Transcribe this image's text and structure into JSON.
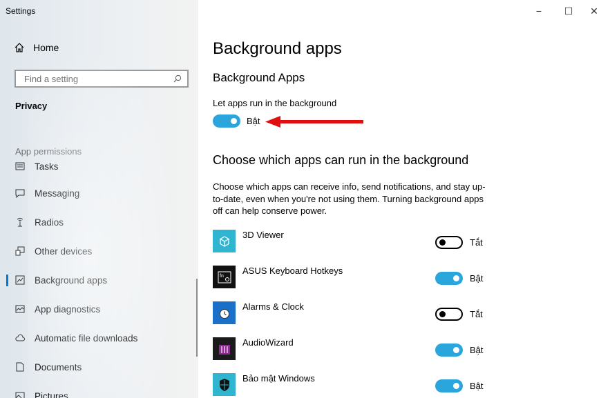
{
  "window": {
    "title": "Settings",
    "minimize": "−",
    "maximize": "☐",
    "close": "✕"
  },
  "sidebar": {
    "home_label": "Home",
    "search_placeholder": "Find a setting",
    "section_label": "Privacy",
    "group_label": "App permissions",
    "items": [
      {
        "label": "Tasks",
        "icon": "tasks-icon"
      },
      {
        "label": "Messaging",
        "icon": "messaging-icon"
      },
      {
        "label": "Radios",
        "icon": "radios-icon"
      },
      {
        "label": "Other devices",
        "icon": "other-devices-icon"
      },
      {
        "label": "Background apps",
        "icon": "background-apps-icon",
        "active": true
      },
      {
        "label": "App diagnostics",
        "icon": "app-diagnostics-icon"
      },
      {
        "label": "Automatic file downloads",
        "icon": "cloud-icon"
      },
      {
        "label": "Documents",
        "icon": "document-icon"
      },
      {
        "label": "Pictures",
        "icon": "pictures-icon"
      }
    ]
  },
  "main": {
    "title": "Background apps",
    "subtitle": "Background Apps",
    "toggle_label": "Let apps run in the background",
    "toggle_state": "Bật",
    "toggle_on": true,
    "choose_title": "Choose which apps can run in the background",
    "description": "Choose which apps can receive info, send notifications, and stay up-to-date, even when you're not using them. Turning background apps off can help conserve power.",
    "apps": [
      {
        "name": "3D Viewer",
        "state": "Tắt",
        "on": false,
        "icon": "3d-viewer-icon",
        "icon_bg": "#2fb5cf"
      },
      {
        "name": "ASUS Keyboard Hotkeys",
        "state": "Bật",
        "on": true,
        "icon": "asus-keyboard-icon",
        "icon_bg": "#111111"
      },
      {
        "name": "Alarms & Clock",
        "state": "Tắt",
        "on": false,
        "icon": "alarm-clock-icon",
        "icon_bg": "#1a6fc9"
      },
      {
        "name": "AudioWizard",
        "state": "Bật",
        "on": true,
        "icon": "audiowizard-icon",
        "icon_bg": "#1a1a1a"
      },
      {
        "name": "Bảo mật Windows",
        "state": "Bật",
        "on": true,
        "icon": "windows-security-icon",
        "icon_bg": "#2fb5cf"
      }
    ]
  },
  "colors": {
    "accent": "#2aa6dc",
    "annotation_arrow": "#e01010"
  }
}
